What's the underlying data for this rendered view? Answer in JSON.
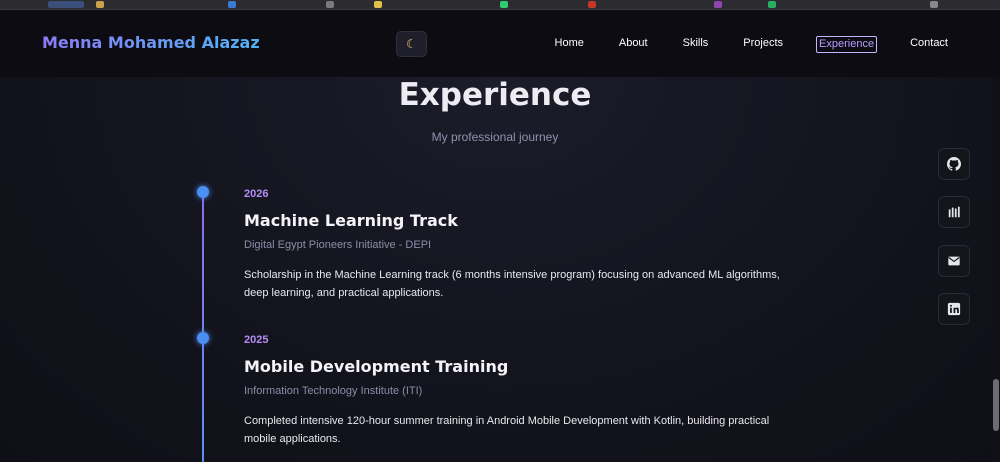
{
  "header": {
    "logo": "Menna Mohamed Alazaz",
    "theme_toggle_icon": "moon-icon",
    "nav": [
      {
        "label": "Home",
        "active": false
      },
      {
        "label": "About",
        "active": false
      },
      {
        "label": "Skills",
        "active": false
      },
      {
        "label": "Projects",
        "active": false
      },
      {
        "label": "Experience",
        "active": true
      },
      {
        "label": "Contact",
        "active": false
      }
    ]
  },
  "section": {
    "title": "Experience",
    "subtitle": "My professional journey"
  },
  "experience": [
    {
      "year": "2026",
      "title": "Machine Learning Track",
      "org": "Digital Egypt Pioneers Initiative - DEPI",
      "description": "Scholarship in the Machine Learning track (6 months intensive program) focusing on advanced ML algorithms, deep learning, and practical applications."
    },
    {
      "year": "2025",
      "title": "Mobile Development Training",
      "org": "Information Technology Institute (ITI)",
      "description": "Completed intensive 120-hour summer training in Android Mobile Development with Kotlin, building practical mobile applications."
    }
  ],
  "social_links": [
    {
      "icon": "github-icon"
    },
    {
      "icon": "kaggle-icon"
    },
    {
      "icon": "mail-icon"
    },
    {
      "icon": "linkedin-icon"
    }
  ],
  "colors": {
    "accent_purple": "#b48cf5",
    "accent_blue": "#4b8ff0",
    "background": "#12121c"
  }
}
